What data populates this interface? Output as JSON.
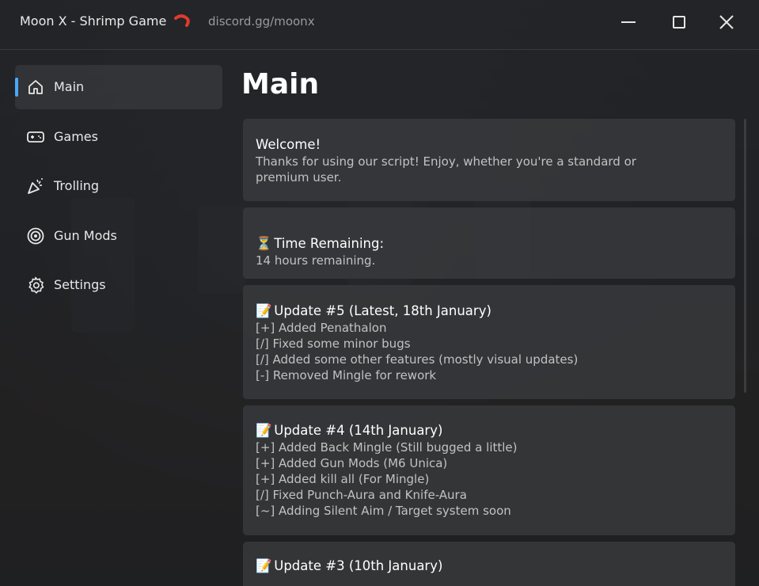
{
  "window": {
    "title": "Moon X - Shrimp Game",
    "title_emoji": "🦐",
    "subtitle": "discord.gg/moonx",
    "controls": [
      "minimize-icon",
      "maximize-icon",
      "close-icon"
    ]
  },
  "sidebar": {
    "items": [
      {
        "label": "Main",
        "icon": "home-icon",
        "active": true
      },
      {
        "label": "Games",
        "icon": "gamepad-icon",
        "active": false
      },
      {
        "label": "Trolling",
        "icon": "party-popper-icon",
        "active": false
      },
      {
        "label": "Gun Mods",
        "icon": "target-icon",
        "active": false
      },
      {
        "label": "Settings",
        "icon": "gear-icon",
        "active": false
      }
    ],
    "accent": "#4aa8ff"
  },
  "main": {
    "title": "Main",
    "cards": [
      {
        "title": "Welcome!",
        "lines": [
          "Thanks for using our script! Enjoy, whether you're a standard or",
          "premium user."
        ]
      },
      {
        "title_emoji": "⏳",
        "title": "Time Remaining:",
        "lines": [
          "14 hours remaining."
        ]
      },
      {
        "title_emoji": "📝",
        "title": "Update #5 (Latest, 18th January)",
        "lines": [
          "[+] Added Penathalon",
          "[/] Fixed some minor bugs",
          "[/] Added some other features (mostly visual updates)",
          "[-] Removed Mingle for rework"
        ]
      },
      {
        "title_emoji": "📝",
        "title": "Update #4 (14th January)",
        "lines": [
          "[+] Added Back Mingle (Still bugged a little)",
          "[+] Added Gun Mods (M6 Unica)",
          "[+] Added kill all (For Mingle)",
          "[/] Fixed Punch-Aura and Knife-Aura",
          "[~] Adding Silent Aim / Target system soon"
        ]
      },
      {
        "title_emoji": "📝",
        "title": "Update #3 (10th January)",
        "lines": []
      }
    ]
  }
}
